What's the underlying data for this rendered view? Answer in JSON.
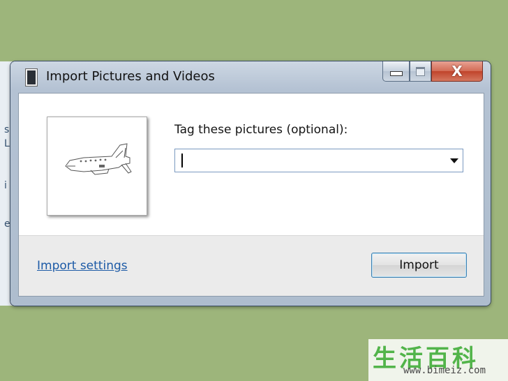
{
  "window": {
    "title": "Import Pictures and Videos",
    "controls": {
      "minimize_icon": "minimize-icon",
      "maximize_icon": "maximize-icon",
      "close_icon": "close-icon",
      "close_glyph": "X"
    }
  },
  "dialog": {
    "tag_label": "Tag these pictures (optional):",
    "tag_value": "",
    "import_settings_link": "Import settings",
    "import_button": "Import"
  },
  "thumbnail": {
    "icon": "airplane-sketch"
  },
  "watermark": {
    "text": "生活百科",
    "url": "www.bimeiz.com"
  },
  "colors": {
    "background": "#9db57b",
    "link": "#1c5aa6",
    "close_button": "#c0432b"
  }
}
